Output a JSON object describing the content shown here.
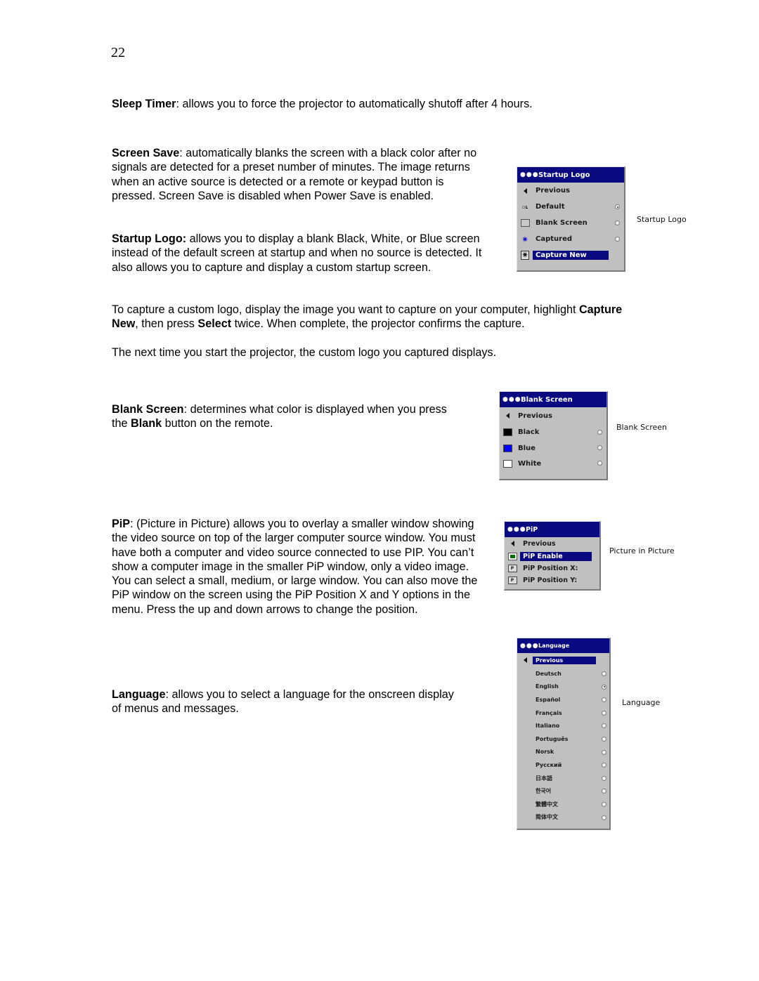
{
  "page_number": "22",
  "paragraphs": {
    "sleep_timer": {
      "term": "Sleep Timer",
      "text": ": allows you to force the projector to automatically shutoff after 4 hours."
    },
    "screen_save": {
      "term": "Screen Save",
      "text": ": automatically blanks the screen with a black color after no signals are detected for a preset number of minutes. The image returns when an active  source is detected or a remote or keypad button is pressed. Screen Save is disabled when Power Save is enabled."
    },
    "startup_logo": {
      "term": "Startup Logo:",
      "text": " allows you to display a blank Black, White, or Blue screen instead of the default screen at startup and when no source is detected. It also allows you to capture and display a custom startup screen."
    },
    "capture": {
      "pre": "To capture a custom logo, display the image you want to capture on your computer, highlight ",
      "b1": "Capture New",
      "mid": ", then press ",
      "b2": "Select",
      "post": " twice. When complete, the projector confirms the capture."
    },
    "next_time": {
      "text": "The next time you start the projector, the custom logo you captured displays."
    },
    "blank_screen": {
      "term": "Blank Screen",
      "pre": ": determines what color is displayed when you press the ",
      "b": "Blank",
      "post": " button on the remote."
    },
    "pip": {
      "term": "PiP",
      "text": ": (Picture in Picture) allows you to overlay a smaller window showing the video source on top of the larger computer source  window. You must have both a computer and video source connected to use PIP. You can’t show a computer image in the smaller PiP window, only a video image. You can select a small, medium, or large window. You can also move the PiP window on the screen using the PiP Position X and Y options in the menu. Press the up and down arrows to change the position."
    },
    "language": {
      "term": "Language",
      "text": ": allows you to select a language for the onscreen display of menus and messages."
    }
  },
  "menus": {
    "startup_logo": {
      "title": "Startup Logo",
      "caption": "Startup Logo",
      "items": [
        {
          "label": "Previous",
          "icon": "back-arrow-icon"
        },
        {
          "label": "Default",
          "icon": "logo-icon",
          "radio": true,
          "selected": true
        },
        {
          "label": "Blank Screen",
          "icon": "blank-screen-icon",
          "radio": true,
          "selected": false
        },
        {
          "label": "Captured",
          "icon": "captured-icon",
          "radio": true,
          "selected": false
        },
        {
          "label": "Capture New",
          "icon": "capture-new-icon",
          "highlighted": true
        }
      ]
    },
    "blank_screen": {
      "title": "Blank Screen",
      "caption": "Blank Screen",
      "items": [
        {
          "label": "Previous",
          "icon": "back-arrow-icon"
        },
        {
          "label": "Black",
          "swatch": "#000000",
          "radio": true,
          "selected": false
        },
        {
          "label": "Blue",
          "swatch": "#0000ff",
          "radio": true,
          "selected": false
        },
        {
          "label": "White",
          "swatch": "#ffffff",
          "radio": true,
          "selected": false
        }
      ]
    },
    "pip": {
      "title": "PiP",
      "caption": "Picture in Picture",
      "items": [
        {
          "label": "Previous",
          "icon": "back-arrow-icon"
        },
        {
          "label": "PiP Enable",
          "icon": "checkbox-icon",
          "highlighted": true,
          "checked": true
        },
        {
          "label": "PiP Position X:",
          "icon": "pip-position-icon"
        },
        {
          "label": "PiP Position Y:",
          "icon": "pip-position-icon"
        }
      ]
    },
    "language": {
      "title": "Language",
      "caption": "Language",
      "items": [
        {
          "label": "Previous",
          "icon": "back-arrow-icon",
          "highlighted": true
        },
        {
          "label": "Deutsch",
          "radio": true,
          "selected": false
        },
        {
          "label": "English",
          "radio": true,
          "selected": true
        },
        {
          "label": "Español",
          "radio": true,
          "selected": false
        },
        {
          "label": "Français",
          "radio": true,
          "selected": false
        },
        {
          "label": "Italiano",
          "radio": true,
          "selected": false
        },
        {
          "label": "Português",
          "radio": true,
          "selected": false
        },
        {
          "label": "Norsk",
          "radio": true,
          "selected": false
        },
        {
          "label": "Русский",
          "radio": true,
          "selected": false
        },
        {
          "label": "日本語",
          "radio": true,
          "selected": false
        },
        {
          "label": "한국어",
          "radio": true,
          "selected": false
        },
        {
          "label": "繁體中文",
          "radio": true,
          "selected": false
        },
        {
          "label": "简体中文",
          "radio": true,
          "selected": false
        }
      ]
    }
  },
  "colors": {
    "menu_bg": "#c0c0c0",
    "menu_highlight": "#0a0a80",
    "pip_check": "#0a6a0a"
  }
}
